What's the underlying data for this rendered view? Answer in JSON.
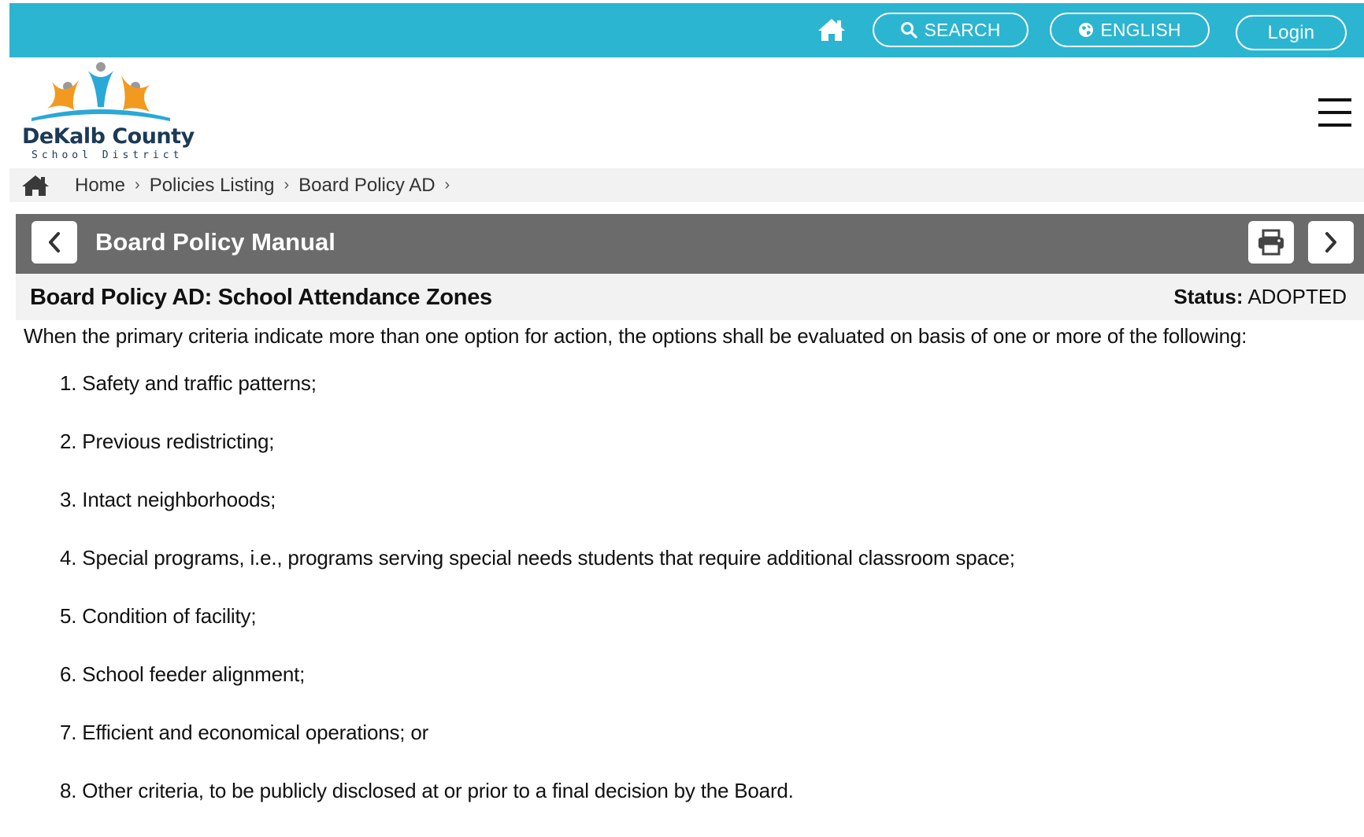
{
  "topbar": {
    "home_icon": "home-icon",
    "search_label": "SEARCH",
    "language_label": "ENGLISH",
    "login_label": "Login",
    "color": "#2cb5d1"
  },
  "header": {
    "logo_name": "DeKalb County",
    "logo_sub": "School District",
    "menu_icon": "hamburger-menu-icon"
  },
  "breadcrumb": {
    "items": [
      {
        "label": "Home"
      },
      {
        "label": "Policies Listing"
      },
      {
        "label": "Board Policy AD"
      }
    ],
    "separator": "›"
  },
  "manual": {
    "title": "Board Policy Manual",
    "bar_color": "#6b6b6b"
  },
  "policy": {
    "title": "Board Policy AD: School Attendance Zones",
    "status_label": "Status:",
    "status_value": "ADOPTED",
    "intro": "When the primary criteria indicate more than one option for action, the options shall be evaluated on basis of one or more of the following:",
    "criteria": [
      "1. Safety and traffic patterns;",
      "2. Previous redistricting;",
      "3. Intact neighborhoods;",
      "4. Special programs, i.e., programs serving special needs students that require additional classroom space;",
      "5. Condition of facility;",
      "6. School feeder alignment;",
      "7. Efficient and economical operations; or",
      "8. Other criteria, to be publicly disclosed at or prior to a final decision by the Board."
    ]
  }
}
